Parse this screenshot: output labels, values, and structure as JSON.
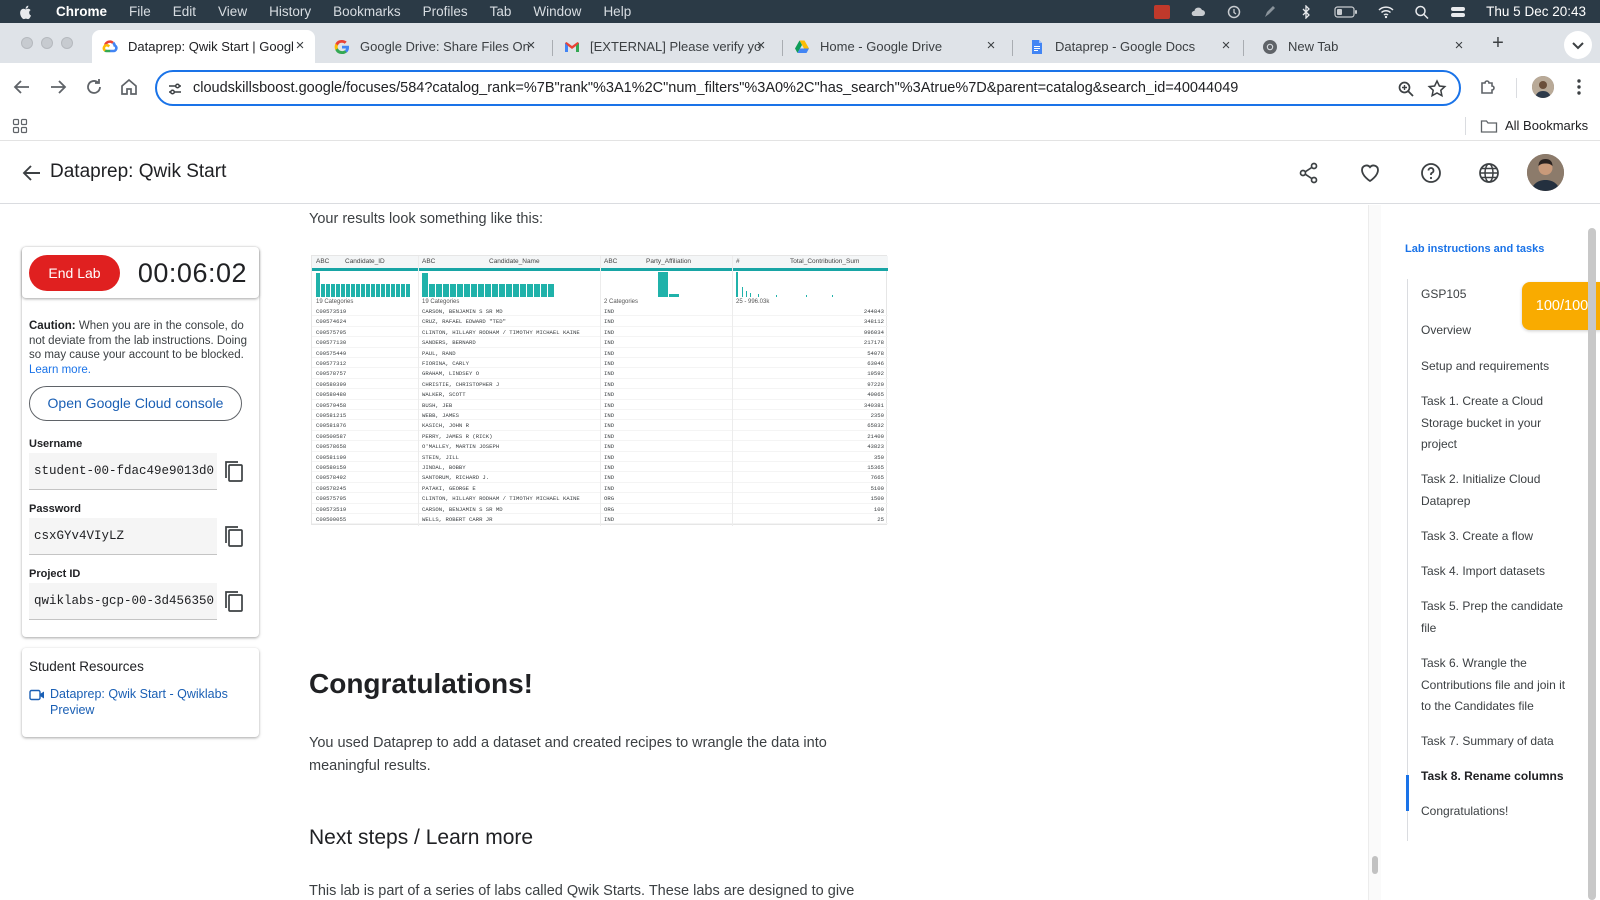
{
  "menubar": {
    "app": "Chrome",
    "items": [
      "File",
      "Edit",
      "View",
      "History",
      "Bookmarks",
      "Profiles",
      "Tab",
      "Window",
      "Help"
    ],
    "clock": "Thu 5 Dec  20:43"
  },
  "tabs": [
    {
      "title": "Dataprep: Qwik Start | Googl",
      "icon": "google-cloud-icon",
      "active": true
    },
    {
      "title": "Google Drive: Share Files On",
      "icon": "google-icon"
    },
    {
      "title": "[EXTERNAL] Please verify yo",
      "icon": "gmail-icon"
    },
    {
      "title": "Home - Google Drive",
      "icon": "drive-icon"
    },
    {
      "title": "Dataprep - Google Docs",
      "icon": "docs-icon"
    },
    {
      "title": "New Tab",
      "icon": "chrome-icon"
    }
  ],
  "toolbar": {
    "url": "cloudskillsboost.google/focuses/584?catalog_rank=%7B\"rank\"%3A1%2C\"num_filters\"%3A0%2C\"has_search\"%3Atrue%7D&parent=catalog&search_id=40044049"
  },
  "bookmarks": {
    "all_bookmarks": "All Bookmarks"
  },
  "header": {
    "title": "Dataprep: Qwik Start"
  },
  "lab": {
    "end_lab": "End Lab",
    "timer": "00:06:02",
    "caution_bold": "Caution:",
    "caution_text": " When you are in the console, do not deviate from the lab instructions. Doing so may cause your account to be blocked.",
    "learn_more": "Learn more.",
    "open_console": "Open Google Cloud console",
    "username_label": "Username",
    "username": "student-00-fdac49e9013d0",
    "password_label": "Password",
    "password": "csxGYv4VIyLZ",
    "project_label": "Project ID",
    "project": "qwiklabs-gcp-00-3d456350"
  },
  "resources": {
    "title": "Student Resources",
    "link": "Dataprep: Qwik Start - Qwiklabs Preview"
  },
  "content": {
    "results_intro": "Your results look something like this:",
    "congrats_heading": "Congratulations!",
    "congrats_text": "You used Dataprep to add a dataset and created recipes to wrangle the data into meaningful results.",
    "next_heading": "Next steps / Learn more",
    "next_text": "This lab is part of a series of labs called Qwik Starts. These labs are designed to give"
  },
  "preview": {
    "columns": [
      "Candidate_ID",
      "Candidate_Name",
      "Party_Affiliation",
      "Total_Contribution_Sum"
    ],
    "type_tags": [
      "ABC",
      "ABC",
      "ABC",
      "#"
    ],
    "summaries": [
      "19 Categories",
      "19 Categories",
      "2 Categories",
      "25 - 996.03k"
    ],
    "rows": [
      [
        "C00573519",
        "CARSON, BENJAMIN S SR MD",
        "IND",
        "244843"
      ],
      [
        "C00574624",
        "CRUZ, RAFAEL EDWARD \"TED\"",
        "IND",
        "348112"
      ],
      [
        "C00575795",
        "CLINTON, HILLARY RODHAM / TIMOTHY MICHAEL KAINE",
        "IND",
        "996034"
      ],
      [
        "C00577130",
        "SANDERS, BERNARD",
        "IND",
        "217178"
      ],
      [
        "C00575449",
        "PAUL, RAND",
        "IND",
        "54078"
      ],
      [
        "C00577312",
        "FIORINA, CARLY",
        "IND",
        "63046"
      ],
      [
        "C00578757",
        "GRAHAM, LINDSEY O",
        "IND",
        "19592"
      ],
      [
        "C00580399",
        "CHRISTIE, CHRISTOPHER J",
        "IND",
        "97220"
      ],
      [
        "C00580480",
        "WALKER, SCOTT",
        "IND",
        "40065"
      ],
      [
        "C00579458",
        "BUSH, JEB",
        "IND",
        "340381"
      ],
      [
        "C00581215",
        "WEBB, JAMES",
        "IND",
        "2350"
      ],
      [
        "C00581876",
        "KASICH, JOHN R",
        "IND",
        "65832"
      ],
      [
        "C00500587",
        "PERRY, JAMES R (RICK)",
        "IND",
        "21400"
      ],
      [
        "C00578658",
        "O'MALLEY, MARTIN JOSEPH",
        "IND",
        "43823"
      ],
      [
        "C00581199",
        "STEIN, JILL",
        "IND",
        "350"
      ],
      [
        "C00580159",
        "JINDAL, BOBBY",
        "IND",
        "15365"
      ],
      [
        "C00578492",
        "SANTORUM, RICHARD J.",
        "IND",
        "7665"
      ],
      [
        "C00578245",
        "PATAKI, GEORGE E",
        "IND",
        "5100"
      ],
      [
        "C00575795",
        "CLINTON, HILLARY RODHAM / TIMOTHY MICHAEL KAINE",
        "ORG",
        "1500"
      ],
      [
        "C00573519",
        "CARSON, BENJAMIN S SR MD",
        "ORG",
        "100"
      ],
      [
        "C00500055",
        "WELLS, ROBERT CARR JR",
        "IND",
        "25"
      ]
    ]
  },
  "sidebar": {
    "title": "Lab instructions and tasks",
    "score": "100/100",
    "items": [
      "GSP105",
      "Overview",
      "Setup and requirements",
      "Task 1. Create a Cloud Storage bucket in your project",
      "Task 2. Initialize Cloud Dataprep",
      "Task 3. Create a flow",
      "Task 4. Import datasets",
      "Task 5. Prep the candidate file",
      "Task 6. Wrangle the Contributions file and join it to the Candidates file",
      "Task 7. Summary of data",
      "Task 8. Rename columns",
      "Congratulations!"
    ],
    "active_index": 10
  },
  "colors": {
    "accent": "#1a73e8",
    "end_lab": "#e02020",
    "score": "#f9ab00",
    "dataprep_teal": "#18a5a5"
  }
}
